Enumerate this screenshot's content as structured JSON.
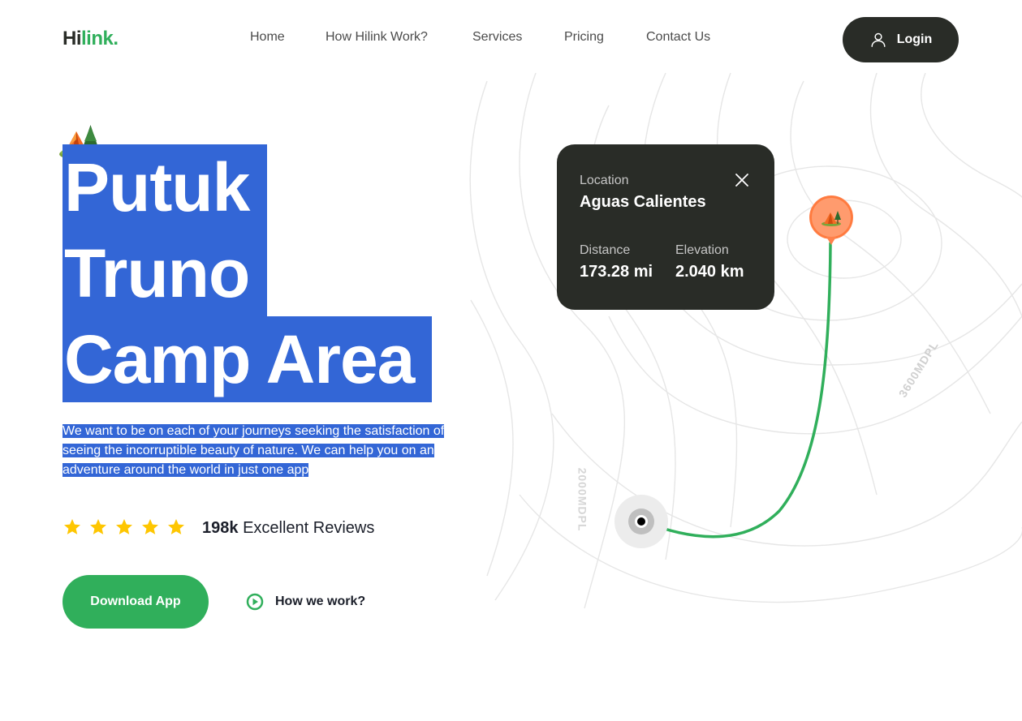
{
  "nav": {
    "logo_part1": "Hi",
    "logo_part2": "link.",
    "links": [
      "Home",
      "How Hilink Work?",
      "Services",
      "Pricing",
      "Contact Us"
    ],
    "login_label": "Login"
  },
  "hero": {
    "title_lines": [
      "Putuk",
      "Truno",
      "Camp Area"
    ],
    "description": "We want to be on each of your journeys seeking the satisfaction of seeing the incorruptible beauty of nature. We can help you on an adventure around the world in just one app",
    "rating_stars": 5,
    "reviews_count": "198k",
    "reviews_label": "Excellent Reviews",
    "download_label": "Download App",
    "how_label": "How we work?"
  },
  "card": {
    "location_label": "Location",
    "location_value": "Aguas Calientes",
    "distance_label": "Distance",
    "distance_value": "173.28 mi",
    "elevation_label": "Elevation",
    "elevation_value": "2.040 km"
  },
  "map": {
    "contour_label_1": "3600MDPL",
    "contour_label_2": "2000MDPL"
  },
  "colors": {
    "accent_green": "#30af5b",
    "dark": "#292c27",
    "selection_blue": "#3366d6",
    "star_yellow": "#fec601",
    "pin_orange": "#ff814c"
  },
  "icons": [
    "user-icon",
    "star-icon",
    "play-icon",
    "close-icon",
    "camp-icon",
    "map-pin-icon"
  ]
}
